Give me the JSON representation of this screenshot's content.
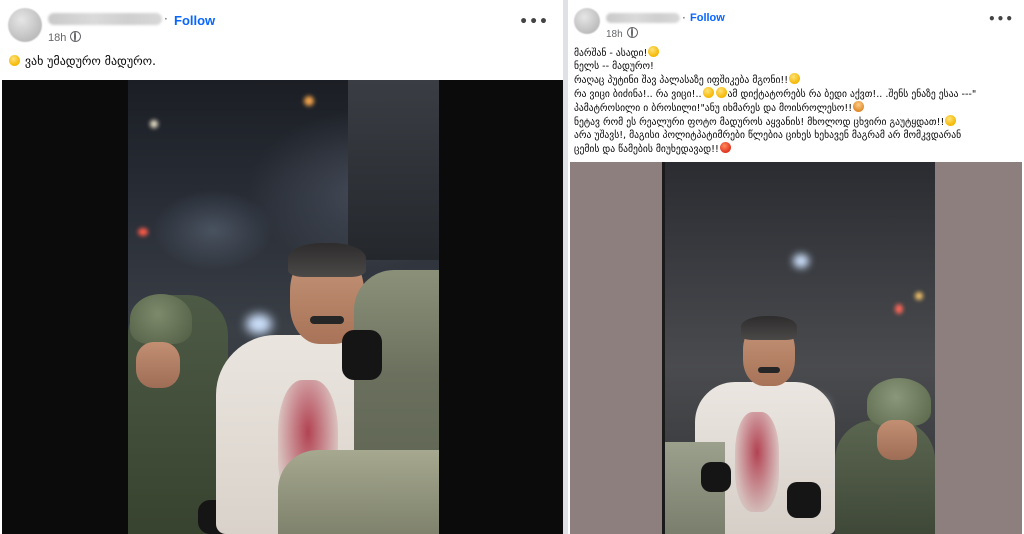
{
  "left_post": {
    "follow_label": "Follow",
    "time": "18h",
    "more_label": "•••",
    "caption": "ვახ უმადურო მადურო.",
    "caption_emoji": "grinning-face-emoji"
  },
  "right_post": {
    "follow_label": "Follow",
    "time": "18h",
    "more_label": "•••",
    "lines": [
      "მარშან -  ასადი!",
      " ნელს -- მადურო!",
      " რაღაც პუტინი შავ პალასაზე იფშიკება მგონი!!",
      " რა ვიცი ბიძინა!.. რა ვიცი!..",
      "ამ დიქტატორებს რა ბედი აქვთ!.. .შენს ენაზე ესაა ---\"",
      "პამატროსილი ი ბროსილი!\"ანუ იხმარეს და მოისროლესო!!",
      " ნეტავ რომ ეს რეალური ფოტო მადუროს აყვანის! მხოლოდ ცხვირი გაუტყდათ!!",
      " არა უშავს!,  მაგისი პოლიტპატიმრები წლებია ციხეს ხეხავენ მაგრამ არ მომკვდარან",
      "ცემის და წამების  მიუხედავად!!"
    ]
  },
  "colors": {
    "follow": "#0866ff",
    "meta": "#65676b",
    "background": "#dfe1e5"
  }
}
